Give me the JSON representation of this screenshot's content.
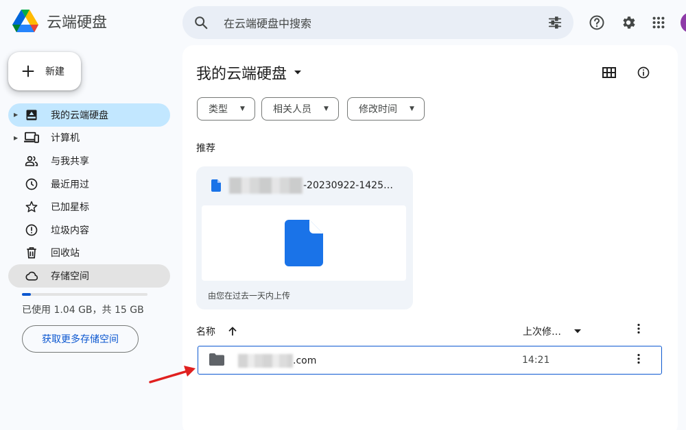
{
  "app": {
    "title": "云端硬盘"
  },
  "search": {
    "placeholder": "在云端硬盘中搜索"
  },
  "sidebar": {
    "new_label": "新建",
    "items": [
      {
        "label": "我的云端硬盘",
        "icon": "my-drive-icon"
      },
      {
        "label": "计算机",
        "icon": "computers-icon"
      },
      {
        "label": "与我共享",
        "icon": "shared-icon"
      },
      {
        "label": "最近用过",
        "icon": "recent-icon"
      },
      {
        "label": "已加星标",
        "icon": "star-icon"
      },
      {
        "label": "垃圾内容",
        "icon": "spam-icon"
      },
      {
        "label": "回收站",
        "icon": "trash-icon"
      },
      {
        "label": "存储空间",
        "icon": "cloud-icon"
      }
    ],
    "storage_used_fraction": 0.07,
    "storage_text": "已使用 1.04 GB，共 15 GB",
    "get_storage_label": "获取更多存储空间"
  },
  "main": {
    "title": "我的云端硬盘",
    "filters": [
      "类型",
      "相关人员",
      "修改时间"
    ],
    "suggested_label": "推荐",
    "card": {
      "name_suffix": "-20230922-1425…",
      "footer": "由您在过去一天内上传"
    },
    "list": {
      "col_name": "名称",
      "col_modified": "上次修…",
      "rows": [
        {
          "name_suffix": ".com",
          "modified": "14:21"
        }
      ]
    }
  },
  "colors": {
    "accent": "#0b57d0",
    "active_bg": "#c2e7ff",
    "annotation_arrow": "#e0201f"
  }
}
